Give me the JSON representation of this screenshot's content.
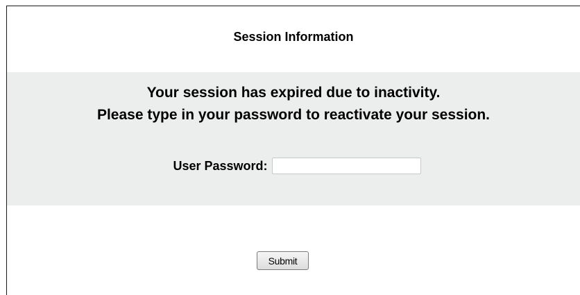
{
  "header": {
    "title": "Session Information"
  },
  "message": {
    "line1": "Your session has expired due to inactivity.",
    "line2": "Please type in your password to reactivate your session."
  },
  "password": {
    "label": "User Password:",
    "value": ""
  },
  "actions": {
    "submit_label": "Submit"
  }
}
